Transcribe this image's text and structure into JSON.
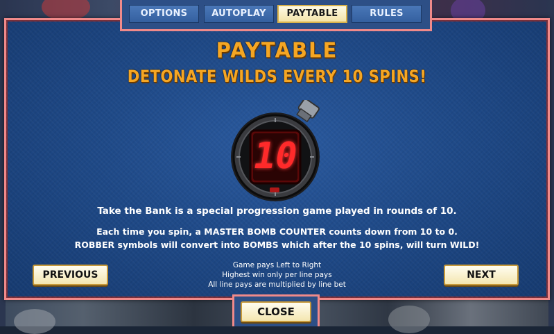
{
  "tabs": [
    {
      "label": "OPTIONS",
      "active": false
    },
    {
      "label": "AUTOPLAY",
      "active": false
    },
    {
      "label": "PAYTABLE",
      "active": true
    },
    {
      "label": "RULES",
      "active": false
    }
  ],
  "title": "PAYTABLE",
  "subtitle": "DETONATE WILDS EVERY 10 SPINS!",
  "counter_value": "10",
  "text": {
    "line1": "Take the Bank is a special progression game played in rounds of 10.",
    "line2": "Each time you spin, a MASTER BOMB COUNTER counts down from 10 to 0.",
    "line3": "ROBBER symbols will convert into BOMBS which after the 10 spins, will turn WILD!",
    "small1": "Game pays Left to Right",
    "small2": "Highest win only per line pays",
    "small3": "All line pays are multiplied by line bet"
  },
  "buttons": {
    "previous": "PREVIOUS",
    "next": "NEXT",
    "close": "CLOSE"
  },
  "colors": {
    "accent_gold": "#f5a623",
    "panel_blue": "#1f4a88",
    "border_pink": "#f08a8a",
    "counter_red": "#ff2a2a"
  },
  "icons": {
    "stopwatch": "bomb-stopwatch-icon"
  }
}
